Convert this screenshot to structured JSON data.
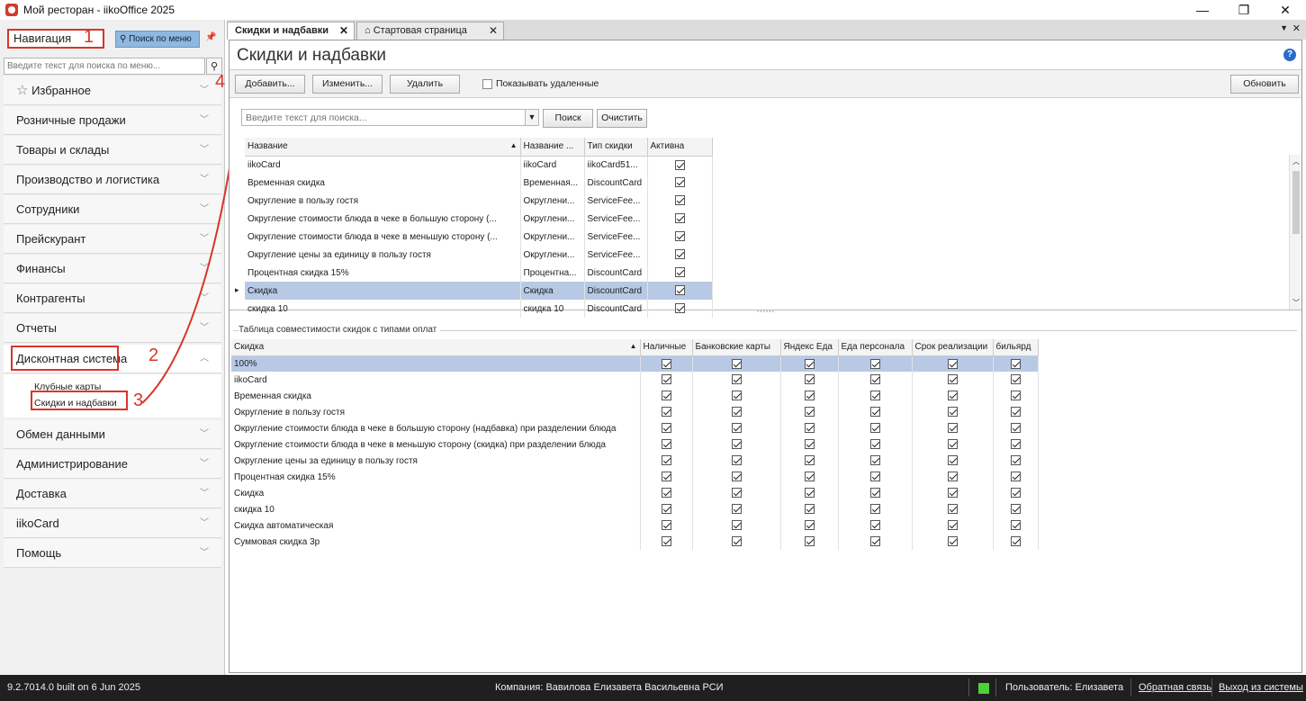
{
  "window": {
    "title": "Мой ресторан - iikoOffice 2025",
    "minimize": "—",
    "maximize": "❐",
    "close": "✕"
  },
  "nav": {
    "title": "Навигация",
    "search_menu_button": "Поиск по меню",
    "search_placeholder": "Введите текст для поиска по меню...",
    "favorites": "Избранное",
    "items_top": [
      "Розничные продажи",
      "Товары и склады",
      "Производство и логистика",
      "Сотрудники",
      "Прейскурант",
      "Финансы",
      "Контрагенты",
      "Отчеты"
    ],
    "expanded": "Дисконтная система",
    "sub_items": [
      "Клубные карты",
      "Скидки и надбавки"
    ],
    "items_bottom": [
      "Обмен данными",
      "Администрирование",
      "Доставка",
      "iikoCard",
      "Помощь"
    ]
  },
  "annotations": [
    "1",
    "2",
    "3",
    "4"
  ],
  "tabs": [
    {
      "label": "Скидки и надбавки"
    },
    {
      "label": "Стартовая страница"
    }
  ],
  "page": {
    "title": "Скидки и надбавки",
    "help": "?"
  },
  "toolbar": {
    "add": "Добавить...",
    "edit": "Изменить...",
    "delete": "Удалить",
    "show_deleted": "Показывать удаленные",
    "refresh": "Обновить"
  },
  "grid_search": {
    "placeholder": "Введите текст для поиска...",
    "search": "Поиск",
    "clear": "Очистить"
  },
  "discounts_table": {
    "columns": [
      "Название",
      "Название ...",
      "Тип скидки",
      "Активна"
    ],
    "rows": [
      {
        "name": "iikoCard",
        "short": "iikoCard",
        "type": "iikoCard51...",
        "active": true
      },
      {
        "name": "Временная скидка",
        "short": "Временная...",
        "type": "DiscountCard",
        "active": true
      },
      {
        "name": "Округление в пользу гостя",
        "short": "Округлени...",
        "type": "ServiceFee...",
        "active": true
      },
      {
        "name": "Округление стоимости блюда в чеке в большую сторону (...",
        "short": "Округлени...",
        "type": "ServiceFee...",
        "active": true
      },
      {
        "name": "Округление стоимости блюда в чеке в меньшую сторону (...",
        "short": "Округлени...",
        "type": "ServiceFee...",
        "active": true
      },
      {
        "name": "Округление цены за единицу в пользу гостя",
        "short": "Округлени...",
        "type": "ServiceFee...",
        "active": true
      },
      {
        "name": "Процентная скидка 15%",
        "short": "Процентна...",
        "type": "DiscountCard",
        "active": true
      },
      {
        "name": "Скидка",
        "short": "Скидка",
        "type": "DiscountCard",
        "active": true
      },
      {
        "name": "скидка 10",
        "short": "скидка 10",
        "type": "DiscountCard",
        "active": true
      }
    ],
    "selected_index": 7
  },
  "compat": {
    "caption": "Таблица совместимости скидок с типами оплат",
    "columns": [
      "Скидка",
      "Наличные",
      "Банковские карты",
      "Яндекс Еда",
      "Еда персонала",
      "Срок реализации",
      "бильярд"
    ],
    "rows": [
      "100%",
      "iikoCard",
      "Временная скидка",
      "Округление в пользу гостя",
      "Округление стоимости блюда в чеке в большую сторону (надбавка) при разделении блюда",
      "Округление стоимости блюда в чеке в меньшую сторону (скидка) при разделении блюда",
      "Округление цены за единицу в пользу гостя",
      "Процентная скидка 15%",
      "Скидка",
      "скидка 10",
      "Скидка автоматическая",
      "Суммовая скидка 3р"
    ],
    "selected_index": 0
  },
  "status": {
    "build": "9.2.7014.0 built on 6 Jun 2025",
    "company": "Компания: Вавилова Елизавета Васильевна РСИ",
    "user": "Пользователь: Елизавета",
    "feedback": "Обратная связь",
    "logout": "Выход из системы"
  },
  "colors": {
    "annotation_red": "#d9342a",
    "selection": "#b7c9e5",
    "status_led": "#4cd137"
  }
}
